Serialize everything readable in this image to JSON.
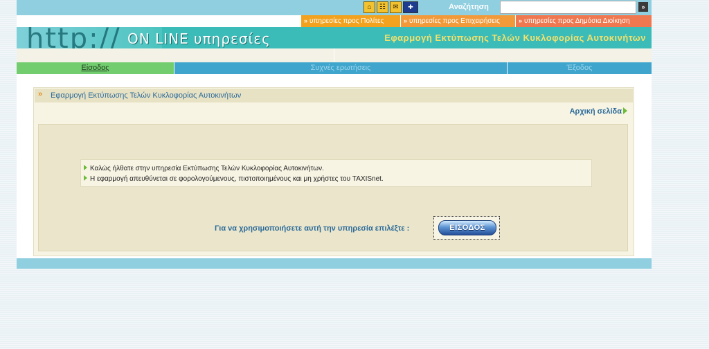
{
  "topbar": {
    "icons": [
      "home-icon",
      "sitemap-icon",
      "contact-icon",
      "uk-flag-icon"
    ],
    "search_label": "Αναζήτηση",
    "search_value": "",
    "search_go": "»"
  },
  "services": [
    {
      "label": "υπηρεσίες προς Πολίτες"
    },
    {
      "label": "υπηρεσίες προς Επιχειρήσεις"
    },
    {
      "label": "υπηρεσίες προς Δημόσια Διοίκηση"
    }
  ],
  "banner": {
    "http_text": "http://",
    "logo_text": "ON LINE υπηρεσίες",
    "title": "Εφαρμογή Εκτύπωσης Τελών Κυκλοφορίας Αυτοκινήτων"
  },
  "nav": [
    {
      "label": "Είσοδος"
    },
    {
      "label": "Συχνές ερωτήσεις"
    },
    {
      "label": "Έξοδος"
    }
  ],
  "panel": {
    "title": "Εφαρμογή Εκτύπωσης Τελών Κυκλοφορίας Αυτοκινήτων",
    "home_link": "Αρχική σελίδα",
    "info_lines": [
      "Καλώς ήλθατε στην υπηρεσία Εκτύπωσης Τελών Κυκλοφορίας Αυτοκινήτων.",
      "Η εφαρμογή απευθύνεται σε φορολογούμενους, πιστοποιημένους και μη χρήστες του TAXISnet."
    ],
    "cta_text": "Για να χρησιμοποιήσετε αυτή την υπηρεσία επιλέξτε :",
    "login_button": "ΕΙΣΟΔΟΣ"
  },
  "colors": {
    "topbar": "#8fcfe0",
    "banner": "#3cbcb8",
    "nav_active": "#72cd6f",
    "nav": "#3fa5cc",
    "link": "#2b6a9a"
  }
}
